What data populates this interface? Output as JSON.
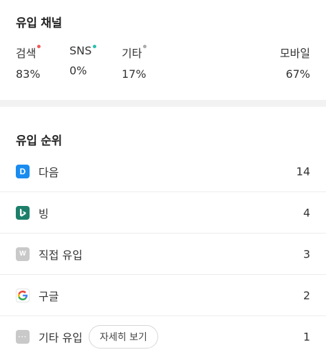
{
  "channels": {
    "title": "유입 채널",
    "items": [
      {
        "label": "검색",
        "value": "83%",
        "dot_color": "#f05a5a"
      },
      {
        "label": "SNS",
        "value": "0%",
        "dot_color": "#27c0b0"
      },
      {
        "label": "기타",
        "value": "17%",
        "dot_color": "#aaaaaa"
      },
      {
        "label": "모바일",
        "value": "67%"
      }
    ]
  },
  "ranking": {
    "title": "유입 순위",
    "detail_label": "자세히 보기",
    "items": [
      {
        "name": "다음",
        "count": "14",
        "icon": "daum-icon",
        "icon_glyph": "D"
      },
      {
        "name": "빙",
        "count": "4",
        "icon": "bing-icon",
        "icon_glyph": "b"
      },
      {
        "name": "직접 유입",
        "count": "3",
        "icon": "direct-icon",
        "icon_glyph": "W"
      },
      {
        "name": "구글",
        "count": "2",
        "icon": "google-icon",
        "icon_glyph": "G"
      },
      {
        "name": "기타 유입",
        "count": "1",
        "icon": "etc-icon",
        "icon_glyph": "···"
      }
    ]
  },
  "colors": {
    "daum": "#1a8cf0",
    "bing": "#1d7f6a",
    "neutral_icon": "#c9c9c9"
  }
}
